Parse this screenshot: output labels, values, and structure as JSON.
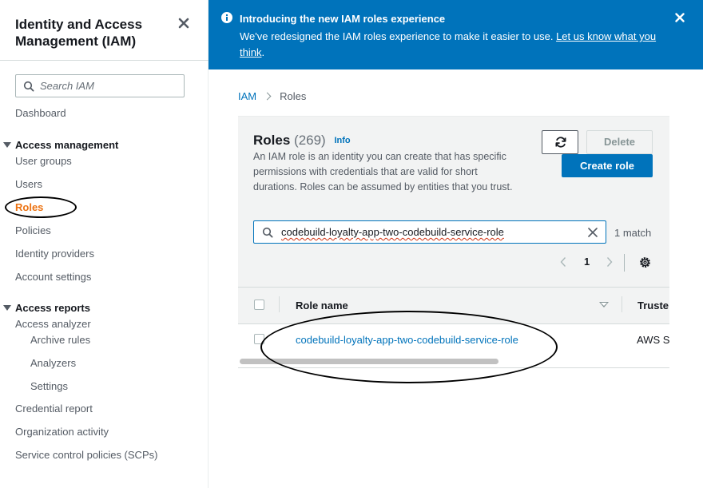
{
  "sidebar": {
    "title": "Identity and Access Management (IAM)",
    "search_placeholder": "Search IAM",
    "dashboard": "Dashboard",
    "access_management": {
      "heading": "Access management",
      "items": [
        "User groups",
        "Users",
        "Roles",
        "Policies",
        "Identity providers",
        "Account settings"
      ],
      "active": "Roles"
    },
    "access_reports": {
      "heading": "Access reports",
      "analyzer": "Access analyzer",
      "analyzer_items": [
        "Archive rules",
        "Analyzers",
        "Settings"
      ],
      "items": [
        "Credential report",
        "Organization activity",
        "Service control policies (SCPs)"
      ]
    }
  },
  "banner": {
    "title": "Introducing the new IAM roles experience",
    "text": "We've redesigned the IAM roles experience to make it easier to use. ",
    "link": "Let us know what you think",
    "period": "."
  },
  "breadcrumb": {
    "root": "IAM",
    "current": "Roles"
  },
  "roles_panel": {
    "title": "Roles",
    "count": "(269)",
    "info": "Info",
    "description": "An IAM role is an identity you can create that has specific permissions with credentials that are valid for short durations. Roles can be assumed by entities that you trust.",
    "delete_label": "Delete",
    "create_label": "Create role",
    "filter_value": "codebuild-loyalty-app-two-codebuild-service-role",
    "match_text": "1 match",
    "page": "1"
  },
  "table": {
    "columns": [
      "Role name",
      "Truste"
    ],
    "rows": [
      {
        "role_name": "codebuild-loyalty-app-two-codebuild-service-role",
        "trusted": "AWS S"
      }
    ]
  },
  "colors": {
    "accent": "#0073bb",
    "active_nav": "#ec7211"
  }
}
